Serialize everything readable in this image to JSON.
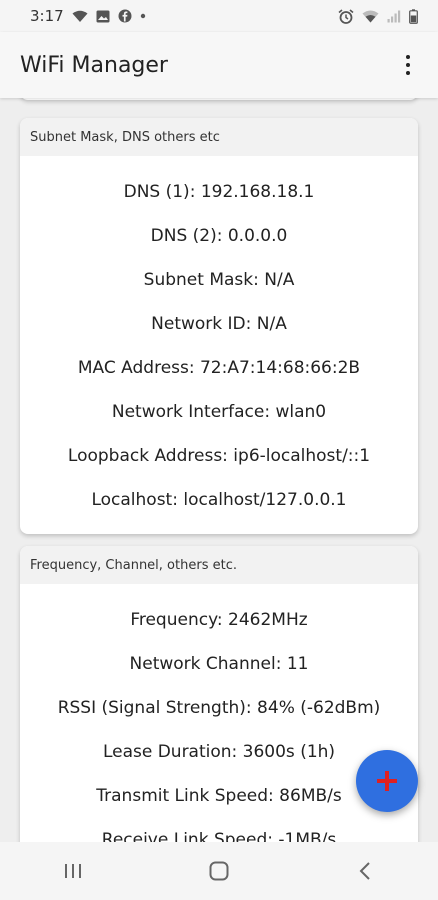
{
  "status_bar": {
    "time": "3:17"
  },
  "app_bar": {
    "title": "WiFi Manager"
  },
  "cards": {
    "subnet": {
      "header": "Subnet Mask, DNS others etc",
      "rows": [
        "DNS (1): 192.168.18.1",
        "DNS (2): 0.0.0.0",
        "Subnet Mask: N/A",
        "Network ID: N/A",
        "MAC Address: 72:A7:14:68:66:2B",
        "Network Interface: wlan0",
        "Loopback Address: ip6-localhost/::1",
        "Localhost: localhost/127.0.0.1"
      ]
    },
    "frequency": {
      "header": "Frequency, Channel, others etc.",
      "rows": [
        "Frequency: 2462MHz",
        "Network Channel: 11",
        "RSSI (Signal Strength): 84% (-62dBm)",
        "Lease Duration: 3600s (1h)",
        "Transmit Link Speed: 86MB/s",
        "Receive Link Speed: -1MB/s"
      ]
    }
  },
  "fab": {
    "icon": "plus-icon",
    "color": "#2f6fe0",
    "icon_color": "#e02020"
  },
  "colors": {
    "card_header_bg": "#f2f2f2",
    "background": "#eeeeee"
  }
}
